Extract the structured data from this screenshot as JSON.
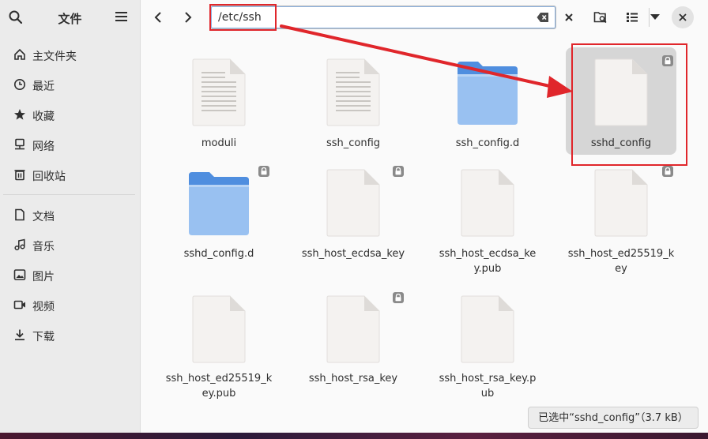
{
  "window": {
    "title": "文件",
    "path": "/etc/ssh",
    "status": "已选中“sshd_config”（3.7 kB）"
  },
  "sidebar": {
    "items": [
      {
        "label": "主文件夹",
        "icon": "home-icon"
      },
      {
        "label": "最近",
        "icon": "clock-icon"
      },
      {
        "label": "收藏",
        "icon": "star-icon"
      },
      {
        "label": "网络",
        "icon": "network-icon"
      },
      {
        "label": "回收站",
        "icon": "trash-icon"
      },
      {
        "label": "文档",
        "icon": "document-icon"
      },
      {
        "label": "音乐",
        "icon": "music-icon"
      },
      {
        "label": "图片",
        "icon": "picture-icon"
      },
      {
        "label": "视频",
        "icon": "video-icon"
      },
      {
        "label": "下载",
        "icon": "download-icon"
      }
    ]
  },
  "files": [
    {
      "name": "moduli",
      "kind": "text",
      "locked": false
    },
    {
      "name": "ssh_config",
      "kind": "text",
      "locked": false
    },
    {
      "name": "ssh_config.d",
      "kind": "folder",
      "locked": false
    },
    {
      "name": "sshd_config",
      "kind": "blank",
      "locked": true,
      "selected": true
    },
    {
      "name": "sshd_config.d",
      "kind": "folder",
      "locked": true
    },
    {
      "name": "ssh_host_ecdsa_key",
      "kind": "blank",
      "locked": true
    },
    {
      "name": "ssh_host_ecdsa_key.pub",
      "kind": "blank",
      "locked": false
    },
    {
      "name": "ssh_host_ed25519_key",
      "kind": "blank",
      "locked": true
    },
    {
      "name": "ssh_host_ed25519_key.pub",
      "kind": "blank",
      "locked": false
    },
    {
      "name": "ssh_host_rsa_key",
      "kind": "blank",
      "locked": true
    },
    {
      "name": "ssh_host_rsa_key.pub",
      "kind": "blank",
      "locked": false
    }
  ],
  "colors": {
    "accent": "#3584e4",
    "annotation": "#e0262b",
    "folder": "#99c1f1"
  }
}
